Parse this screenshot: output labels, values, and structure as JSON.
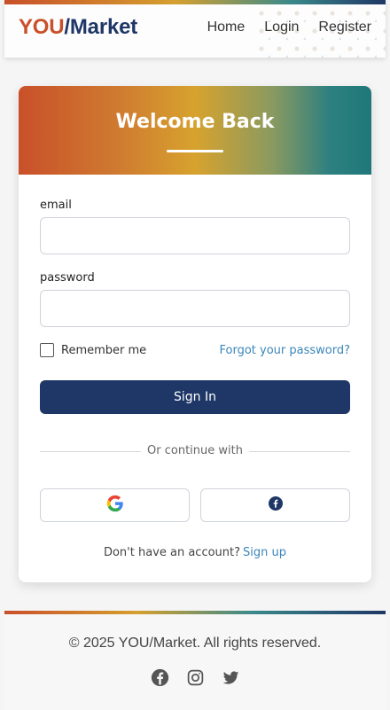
{
  "header": {
    "logo_you": "YOU",
    "logo_rest": "/Market",
    "nav": [
      "Home",
      "Login",
      "Register"
    ]
  },
  "card": {
    "title": "Welcome Back",
    "email_label": "email",
    "email_value": "",
    "password_label": "password",
    "password_value": "",
    "remember_label": "Remember me",
    "forgot_label": "Forgot your password?",
    "signin_label": "Sign In",
    "divider_text": "Or continue with",
    "social": [
      "google-icon",
      "facebook-icon"
    ],
    "signup_text": "Don't have an account?",
    "signup_link": "Sign up"
  },
  "footer": {
    "copyright": "© 2025 YOU/Market. All rights reserved.",
    "icons": [
      "facebook-icon",
      "instagram-icon",
      "twitter-icon"
    ]
  },
  "colors": {
    "brand_orange": "#c9502a",
    "brand_navy": "#1e3767",
    "link_blue": "#3a86b8",
    "gold": "#d5a02f",
    "teal": "#2e8080"
  }
}
